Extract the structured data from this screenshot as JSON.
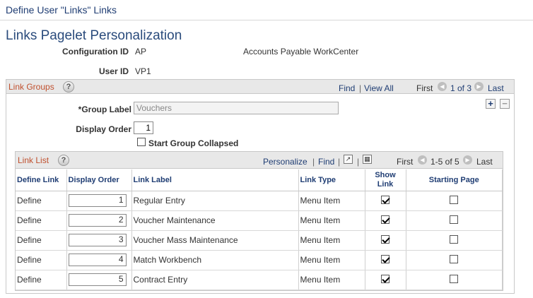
{
  "window": {
    "title": "Define User \"Links\" Links"
  },
  "page": {
    "title": "Links Pagelet Personalization"
  },
  "config": {
    "label": "Configuration ID",
    "value": "AP",
    "description": "Accounts Payable WorkCenter"
  },
  "user": {
    "label": "User ID",
    "value": "VP1"
  },
  "link_groups": {
    "title": "Link Groups",
    "nav": {
      "find": "Find",
      "sep": "|",
      "view_all": "View All",
      "first": "First",
      "count": "1 of 3",
      "last": "Last"
    },
    "group_label": {
      "label": "*Group Label",
      "value": "Vouchers"
    },
    "display_order": {
      "label": "Display Order",
      "value": "1"
    },
    "start_collapsed": {
      "label": "Start Group Collapsed",
      "checked": false
    },
    "add_symbol": "+",
    "remove_symbol": "−"
  },
  "link_list": {
    "title": "Link List",
    "nav": {
      "personalize": "Personalize",
      "sep": "|",
      "find": "Find",
      "sep2": "|",
      "first": "First",
      "count": "1-5 of 5",
      "last": "Last"
    },
    "columns": {
      "define_link": "Define Link",
      "display_order": "Display Order",
      "link_label": "Link Label",
      "link_type": "Link Type",
      "show_link_1": "Show",
      "show_link_2": "Link",
      "starting_page": "Starting Page"
    },
    "rows": [
      {
        "define": "Define",
        "order": "1",
        "label": "Regular Entry",
        "type": "Menu Item",
        "show": true,
        "start": false
      },
      {
        "define": "Define",
        "order": "2",
        "label": "Voucher Maintenance",
        "type": "Menu Item",
        "show": true,
        "start": false
      },
      {
        "define": "Define",
        "order": "3",
        "label": "Voucher Mass Maintenance",
        "type": "Menu Item",
        "show": true,
        "start": false
      },
      {
        "define": "Define",
        "order": "4",
        "label": "Match Workbench",
        "type": "Menu Item",
        "show": true,
        "start": false
      },
      {
        "define": "Define",
        "order": "5",
        "label": "Contract Entry",
        "type": "Menu Item",
        "show": true,
        "start": false
      }
    ]
  },
  "icons": {
    "help": "help-icon",
    "prev": "prev-arrow-icon",
    "next": "next-arrow-icon",
    "zoom": "new-window-icon",
    "download": "download-grid-icon"
  },
  "colors": {
    "accent_title": "#c0502e",
    "link": "#1f3d73",
    "header_bg": "#e8e8e8"
  }
}
